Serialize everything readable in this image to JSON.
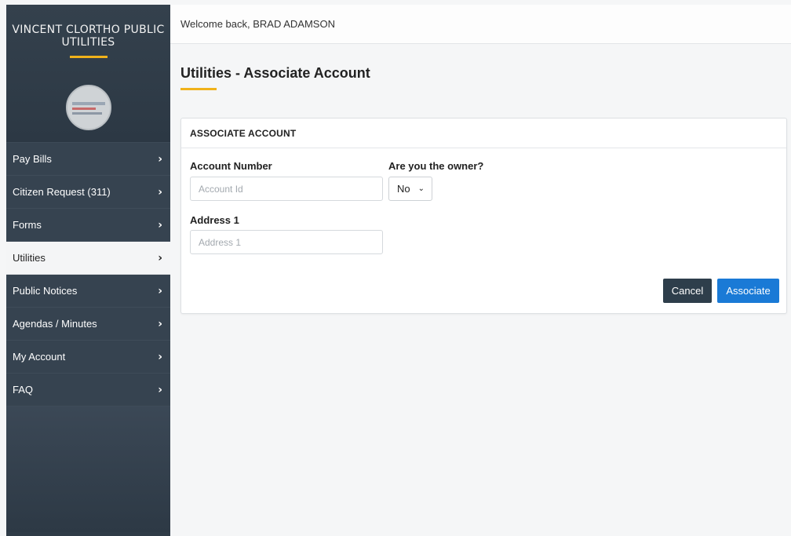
{
  "brand": {
    "title": "VINCENT CLORTHO PUBLIC UTILITIES"
  },
  "sidebar": {
    "items": [
      {
        "label": "Pay Bills",
        "active": false
      },
      {
        "label": "Citizen Request (311)",
        "active": false
      },
      {
        "label": "Forms",
        "active": false
      },
      {
        "label": "Utilities",
        "active": true
      },
      {
        "label": "Public Notices",
        "active": false
      },
      {
        "label": "Agendas / Minutes",
        "active": false
      },
      {
        "label": "My Account",
        "active": false
      },
      {
        "label": "FAQ",
        "active": false
      }
    ],
    "chevron_icon": "chevron-right-icon"
  },
  "header": {
    "welcome": "Welcome back, BRAD ADAMSON"
  },
  "page": {
    "title": "Utilities - Associate Account"
  },
  "card": {
    "header": "ASSOCIATE ACCOUNT",
    "account_number_label": "Account Number",
    "account_number_placeholder": "Account Id",
    "account_number_value": "",
    "owner_label": "Are you the owner?",
    "owner_value": "No",
    "address1_label": "Address 1",
    "address1_placeholder": "Address 1",
    "address1_value": "",
    "cancel_label": "Cancel",
    "associate_label": "Associate"
  },
  "colors": {
    "sidebar_bg": "#2f3b47",
    "accent": "#f0b21a",
    "primary_button": "#1a7ad6",
    "secondary_button": "#2e3e4b"
  }
}
